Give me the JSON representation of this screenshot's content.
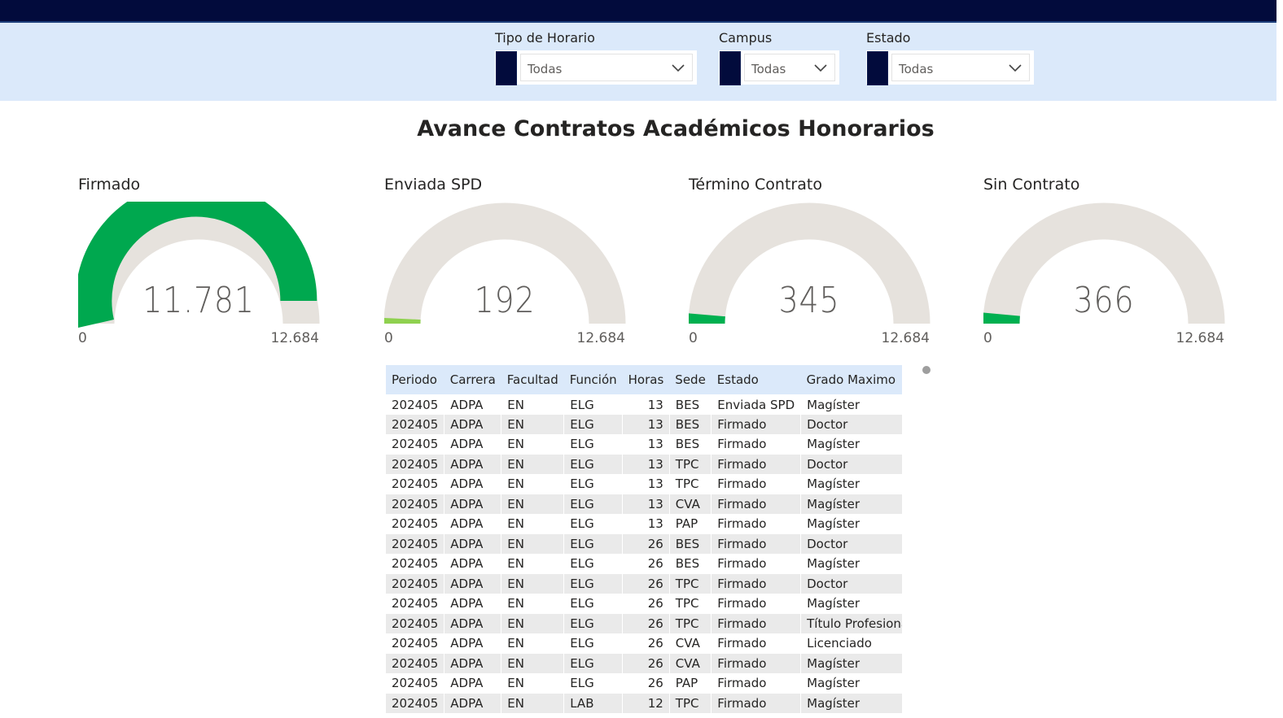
{
  "filters": [
    {
      "label": "Tipo de Horario",
      "value": "Todas"
    },
    {
      "label": "Campus",
      "value": "Todas"
    },
    {
      "label": "Estado",
      "value": "Todas"
    }
  ],
  "title": "Avance Contratos Académicos Honorarios",
  "gauges": [
    {
      "label": "Firmado",
      "value": 11781,
      "value_text": "11.781",
      "min_text": "0",
      "max": 12684,
      "max_text": "12.684",
      "fill_color": "#00a84f"
    },
    {
      "label": "Enviada SPD",
      "value": 192,
      "value_text": "192",
      "min_text": "0",
      "max": 12684,
      "max_text": "12.684",
      "fill_color": "#8fd14f"
    },
    {
      "label": "Término Contrato",
      "value": 345,
      "value_text": "345",
      "min_text": "0",
      "max": 12684,
      "max_text": "12.684",
      "fill_color": "#00b050"
    },
    {
      "label": "Sin Contrato",
      "value": 366,
      "value_text": "366",
      "min_text": "0",
      "max": 12684,
      "max_text": "12.684",
      "fill_color": "#00b050"
    }
  ],
  "colors": {
    "gauge_track": "#e6e2dd",
    "topbar": "#020b3c",
    "filter_band": "#dbe9fa"
  },
  "table": {
    "columns": [
      "Periodo",
      "Carrera",
      "Facultad",
      "Función",
      "Horas",
      "Sede",
      "Estado",
      "Grado Maximo"
    ],
    "rows": [
      [
        "202405",
        "ADPA",
        "EN",
        "ELG",
        "13",
        "BES",
        "Enviada SPD",
        "Magíster"
      ],
      [
        "202405",
        "ADPA",
        "EN",
        "ELG",
        "13",
        "BES",
        "Firmado",
        "Doctor"
      ],
      [
        "202405",
        "ADPA",
        "EN",
        "ELG",
        "13",
        "BES",
        "Firmado",
        "Magíster"
      ],
      [
        "202405",
        "ADPA",
        "EN",
        "ELG",
        "13",
        "TPC",
        "Firmado",
        "Doctor"
      ],
      [
        "202405",
        "ADPA",
        "EN",
        "ELG",
        "13",
        "TPC",
        "Firmado",
        "Magíster"
      ],
      [
        "202405",
        "ADPA",
        "EN",
        "ELG",
        "13",
        "CVA",
        "Firmado",
        "Magíster"
      ],
      [
        "202405",
        "ADPA",
        "EN",
        "ELG",
        "13",
        "PAP",
        "Firmado",
        "Magíster"
      ],
      [
        "202405",
        "ADPA",
        "EN",
        "ELG",
        "26",
        "BES",
        "Firmado",
        "Doctor"
      ],
      [
        "202405",
        "ADPA",
        "EN",
        "ELG",
        "26",
        "BES",
        "Firmado",
        "Magíster"
      ],
      [
        "202405",
        "ADPA",
        "EN",
        "ELG",
        "26",
        "TPC",
        "Firmado",
        "Doctor"
      ],
      [
        "202405",
        "ADPA",
        "EN",
        "ELG",
        "26",
        "TPC",
        "Firmado",
        "Magíster"
      ],
      [
        "202405",
        "ADPA",
        "EN",
        "ELG",
        "26",
        "TPC",
        "Firmado",
        "Título Profesional"
      ],
      [
        "202405",
        "ADPA",
        "EN",
        "ELG",
        "26",
        "CVA",
        "Firmado",
        "Licenciado"
      ],
      [
        "202405",
        "ADPA",
        "EN",
        "ELG",
        "26",
        "CVA",
        "Firmado",
        "Magíster"
      ],
      [
        "202405",
        "ADPA",
        "EN",
        "ELG",
        "26",
        "PAP",
        "Firmado",
        "Magíster"
      ],
      [
        "202405",
        "ADPA",
        "EN",
        "LAB",
        "12",
        "TPC",
        "Firmado",
        "Magíster"
      ]
    ]
  }
}
